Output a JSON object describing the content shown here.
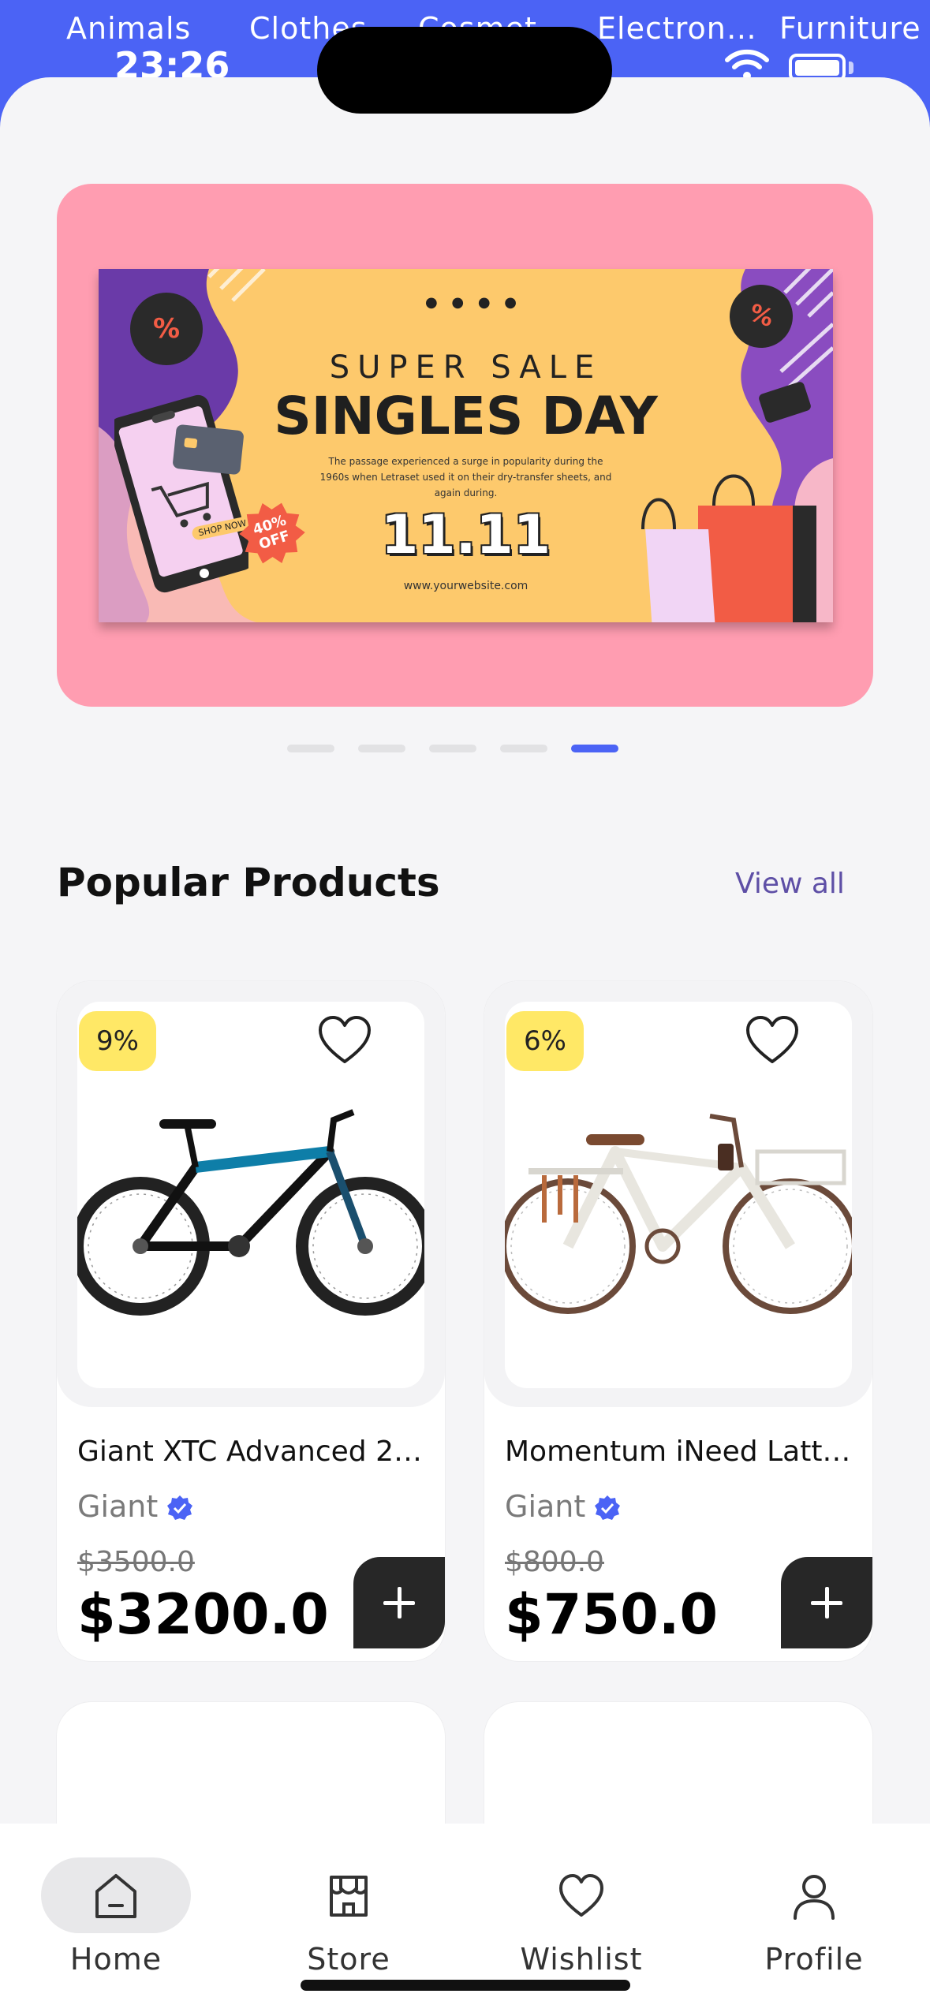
{
  "status_bar": {
    "time": "23:26"
  },
  "categories": [
    "Animals",
    "Clothes",
    "Cosmet",
    "Electron…",
    "Furniture"
  ],
  "banner": {
    "kicker": "SUPER SALE",
    "title": "SINGLES DAY",
    "description": "The passage experienced a surge in popularity during the 1960s when Letraset used it on their dry-transfer sheets, and again during.",
    "date": "11.11",
    "website": "www.yourwebsite.com",
    "shop_now": "SHOP NOW",
    "discount_badge": "40% OFF",
    "percent_tag": "%",
    "slide_count": 5,
    "active_slide": 5
  },
  "section": {
    "title": "Popular Products",
    "view_all": "View all"
  },
  "products": [
    {
      "discount": "9%",
      "name": "Giant XTC Advanced 2…",
      "brand": "Giant",
      "old_price": "$3500.0",
      "price": "$3200.0"
    },
    {
      "discount": "6%",
      "name": "Momentum iNeed Latt…",
      "brand": "Giant",
      "old_price": "$800.0",
      "price": "$750.0"
    }
  ],
  "nav": {
    "items": [
      {
        "label": "Home",
        "icon": "home-icon",
        "active": true
      },
      {
        "label": "Store",
        "icon": "store-icon",
        "active": false
      },
      {
        "label": "Wishlist",
        "icon": "heart-icon",
        "active": false
      },
      {
        "label": "Profile",
        "icon": "person-icon",
        "active": false
      }
    ]
  },
  "colors": {
    "accent": "#4b63f5",
    "banner_bg": "#ff9db1",
    "poster_bg": "#fdc96c",
    "discount_bg": "#ffe866",
    "verified": "#4b63f5"
  }
}
